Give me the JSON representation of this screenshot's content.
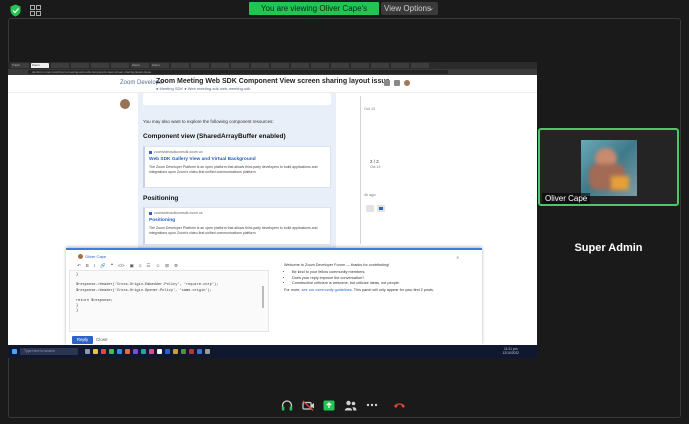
{
  "zoom": {
    "banner": "You are viewing Oliver Cape's screen",
    "view_options": "View Options",
    "participants": [
      {
        "name": "Oliver Cape",
        "active_speaker": true
      },
      {
        "name": "Super Admin"
      }
    ],
    "controls": [
      "headphones-icon",
      "video-off-icon",
      "share-screen-icon",
      "participants-icon",
      "more-icon",
      "leave-call-icon"
    ],
    "colors": {
      "accent_green": "#23c552",
      "leave_red": "#e0403c",
      "background": "#1a1a1a"
    }
  },
  "shared_screen": {
    "browser": {
      "tabs": [
        "Trash",
        "Zoom",
        "",
        "",
        "",
        "",
        "Zoom",
        "Zoom",
        "",
        "",
        "",
        "",
        "",
        "",
        "",
        "",
        "",
        "",
        "",
        "",
        ""
      ],
      "url": "devforum.zoom.us/t/zoom-meeting-web-sdk-component-view-screen-sharing-layout-issue"
    },
    "page": {
      "logo": "Zoom Developer",
      "title": "Zoom Meeting Web SDK Component View screen sharing layout issue",
      "breadcrumbs": "● Meeting SDK  ● Web  meeting-sdk  web-meeting-sdk",
      "explore_text": "You may also want to explore the following component resources:",
      "section1": "Component view (SharedArrayBuffer enabled)",
      "card1": {
        "source": "zoomvideosdkcomsdk.zoom.us",
        "title": "Web SDK Gallery View and Virtual Background",
        "desc": "The Zoom Developer Platform is an open platform that allows third-party developers to build applications and integrations upon Zoom's video-first unified communications platform."
      },
      "section2": "Positioning",
      "card2": {
        "source": "zoomvideosdkcomsdk.zoom.us",
        "title": "Positioning",
        "desc": "The Zoom Developer Platform is an open platform that allows third-party developers to build applications and integrations upon Zoom's video-first unified communications platform."
      },
      "timeline": {
        "date_top": "Oct 12",
        "count": "2 / 2",
        "date_bottom": "Oct 13",
        "ago": "4h ago"
      }
    },
    "composer": {
      "reply_to": "Oliver Cape",
      "toolbar": [
        "↶",
        "B",
        "I",
        "🔗",
        "❝",
        "</>",
        "▣",
        "≡",
        "☰",
        "☺",
        "⊞",
        "⚙"
      ],
      "code_lines": [
        "}",
        "",
        "$response->header('Cross-Origin-Embedder-Policy', 'require-corp');",
        "$response->header('Cross-Origin-Opener-Policy', 'same-origin');",
        "",
        "return $response;",
        "}",
        "}"
      ],
      "reply_label": "Reply",
      "close_label": "Close",
      "welcome_title": "Welcome to Zoom Developer Forum — thanks for contributing!",
      "tips": [
        "Be kind to your fellow community members.",
        "Does your reply improve the conversation?",
        "Constructive criticism is welcome, but criticize ideas, not people."
      ],
      "footer_pre": "For more, ",
      "footer_link": "see our community guidelines",
      "footer_post": ". This panel will only appear for your first 2 posts."
    },
    "taskbar": {
      "search": "Type here to search",
      "time": "11:21 pm",
      "date": "12/10/2022"
    }
  }
}
